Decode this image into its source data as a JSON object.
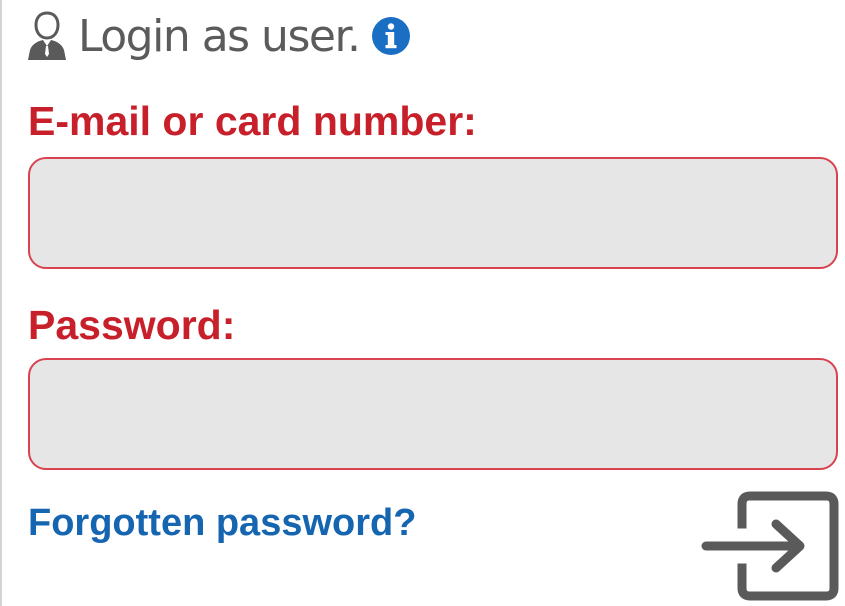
{
  "header": {
    "title": "Login as user.",
    "user_icon": "user-icon",
    "info_icon": "info-icon"
  },
  "form": {
    "email_label": "E-mail or card number:",
    "email_value": "",
    "email_placeholder": "",
    "password_label": "Password:",
    "password_value": "",
    "password_placeholder": "",
    "forgot_link": "Forgotten password?",
    "submit_icon": "login-enter-icon"
  },
  "colors": {
    "label_red": "#c8202a",
    "input_border": "#d9434f",
    "input_background": "#e6e6e6",
    "link_blue": "#1565b0",
    "info_blue": "#1a6fc4",
    "header_gray": "#5b5b5b",
    "icon_gray": "#5a5a5a"
  }
}
